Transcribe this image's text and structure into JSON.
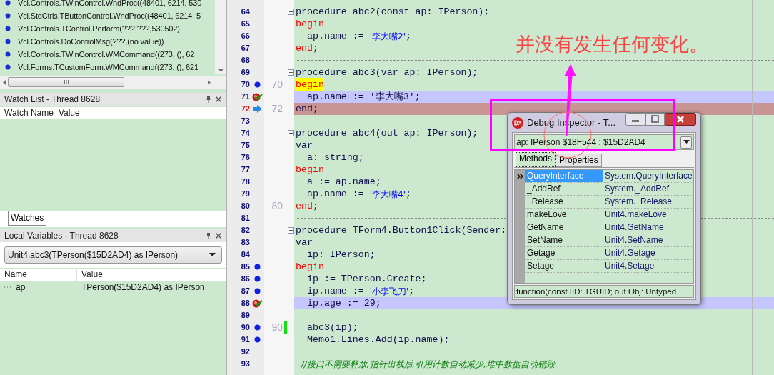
{
  "call_stack": {
    "frames": [
      "Vcl.Controls.TWinControl.WndProc((48401, 6214, 530",
      "Vcl.StdCtrls.TButtonControl.WndProc((48401, 6214, 5",
      "Vcl.Controls.TControl.Perform(???,???,530502)",
      "Vcl.Controls.DoControlMsg(???,(no value))",
      "Vcl.Controls.TWinControl.WMCommand((273, (), 62",
      "Vcl.Forms.TCustomForm.WMCommand((273, (), 621"
    ]
  },
  "watch_list": {
    "title": "Watch List - Thread 8628",
    "columns": [
      "Watch Name",
      "Value"
    ]
  },
  "bottom_tabs": [
    {
      "label": "Watches",
      "selected": true
    }
  ],
  "local_variables": {
    "title": "Local Variables - Thread 8628",
    "frame": "Unit4.abc3(TPerson($15D2AD4) as IPerson)",
    "columns": [
      "Name",
      "Value"
    ],
    "rows": [
      {
        "name": "ap",
        "value": "TPerson($15D2AD4) as IPerson"
      }
    ]
  },
  "editor": {
    "lines": [
      {
        "number": "64",
        "kind": "header",
        "modified": false,
        "tokens": [
          {
            "text": "procedure abc2(const ap: IPerson);",
            "kind": "plain"
          }
        ]
      },
      {
        "number": "65",
        "kind": "code",
        "modified": false,
        "tokens": [
          {
            "text": "begin",
            "kind": "block"
          }
        ]
      },
      {
        "number": "66",
        "kind": "code",
        "modified": false,
        "tokens": [
          {
            "text": "  ap.name := ",
            "kind": "plain"
          },
          {
            "text": "'李大嘴2'",
            "kind": "string"
          },
          {
            "text": ";",
            "kind": "plain"
          }
        ]
      },
      {
        "number": "67",
        "kind": "code",
        "modified": false,
        "tokens": [
          {
            "text": "end",
            "kind": "block"
          },
          {
            "text": ";",
            "kind": "plain"
          }
        ]
      },
      {
        "number": "68",
        "kind": "separator",
        "modified": false
      },
      {
        "number": "69",
        "kind": "header",
        "modified": false,
        "tokens": [
          {
            "text": "procedure abc3(var ap: IPerson);",
            "kind": "plain"
          }
        ]
      },
      {
        "number": "70",
        "kind": "code",
        "marker": {
          "kind": "breakpoint"
        },
        "label": "70",
        "modified": false,
        "tokens": [
          {
            "text": "begin",
            "kind": "block_current"
          }
        ]
      },
      {
        "number": "71",
        "kind": "code",
        "marker": {
          "kind": "verified"
        },
        "modified": false,
        "tokens": [
          {
            "text": "  ap.name := ",
            "kind": "plain"
          },
          {
            "text": "'李大嘴3'",
            "kind": "string"
          },
          {
            "text": ";",
            "kind": "plain"
          }
        ]
      },
      {
        "number": "72",
        "kind": "code",
        "marker": {
          "kind": "execution"
        },
        "label": "72",
        "modified": false,
        "tokens": [
          {
            "text": "end",
            "kind": "block"
          },
          {
            "text": ";",
            "kind": "plain"
          }
        ]
      },
      {
        "number": "73",
        "kind": "separator",
        "modified": false
      },
      {
        "number": "74",
        "kind": "header",
        "modified": false,
        "tokens": [
          {
            "text": "procedure abc4(out ap: IPerson);",
            "kind": "plain"
          }
        ]
      },
      {
        "number": "75",
        "kind": "code",
        "modified": false,
        "tokens": [
          {
            "text": "var",
            "kind": "plain"
          }
        ]
      },
      {
        "number": "76",
        "kind": "code",
        "modified": false,
        "tokens": [
          {
            "text": "  a: string;",
            "kind": "plain"
          }
        ]
      },
      {
        "number": "77",
        "kind": "code",
        "modified": false,
        "tokens": [
          {
            "text": "begin",
            "kind": "block"
          }
        ]
      },
      {
        "number": "78",
        "kind": "code",
        "modified": false,
        "tokens": [
          {
            "text": "  a := ap.name;",
            "kind": "plain"
          }
        ]
      },
      {
        "number": "79",
        "kind": "code",
        "modified": false,
        "tokens": [
          {
            "text": "  ap.name := ",
            "kind": "plain"
          },
          {
            "text": "'李大嘴4'",
            "kind": "string"
          },
          {
            "text": ";",
            "kind": "plain"
          }
        ]
      },
      {
        "number": "80",
        "kind": "code",
        "label": "80",
        "modified": false,
        "tokens": [
          {
            "text": "end",
            "kind": "block"
          },
          {
            "text": ";",
            "kind": "plain"
          }
        ]
      },
      {
        "number": "81",
        "kind": "separator",
        "modified": false
      },
      {
        "number": "82",
        "kind": "header",
        "modified": false,
        "tokens": [
          {
            "text": "procedure TForm4.Button1Click(Sender:",
            "kind": "plain"
          }
        ]
      },
      {
        "number": "83",
        "kind": "code",
        "modified": false,
        "tokens": [
          {
            "text": "var",
            "kind": "plain"
          }
        ]
      },
      {
        "number": "84",
        "kind": "code",
        "modified": false,
        "tokens": [
          {
            "text": "  ip: IPerson;",
            "kind": "plain"
          }
        ]
      },
      {
        "number": "85",
        "kind": "code",
        "marker": {
          "kind": "breakpoint"
        },
        "modified": false,
        "tokens": [
          {
            "text": "begin",
            "kind": "block"
          }
        ]
      },
      {
        "number": "86",
        "kind": "code",
        "marker": {
          "kind": "breakpoint"
        },
        "modified": false,
        "tokens": [
          {
            "text": "  ip := TPerson.Create;",
            "kind": "plain"
          }
        ]
      },
      {
        "number": "87",
        "kind": "code",
        "marker": {
          "kind": "breakpoint"
        },
        "modified": false,
        "tokens": [
          {
            "text": "  ip.name := ",
            "kind": "plain"
          },
          {
            "text": "'小李飞刀'",
            "kind": "string"
          },
          {
            "text": ";",
            "kind": "plain"
          }
        ]
      },
      {
        "number": "88",
        "kind": "code",
        "marker": {
          "kind": "verified"
        },
        "modified": false,
        "tokens": [
          {
            "text": "  ip.age := 29;",
            "kind": "plain"
          }
        ]
      },
      {
        "number": "89",
        "kind": "code",
        "modified": false
      },
      {
        "number": "90",
        "kind": "code",
        "marker": {
          "kind": "breakpoint"
        },
        "label": "90",
        "modified": true,
        "tokens": [
          {
            "text": "  abc3(ip);",
            "kind": "plain"
          }
        ]
      },
      {
        "number": "91",
        "kind": "code",
        "marker": {
          "kind": "breakpoint"
        },
        "modified": false,
        "tokens": [
          {
            "text": "  Memo1.Lines.Add(ip.name);",
            "kind": "plain"
          }
        ]
      },
      {
        "number": "92",
        "kind": "code",
        "modified": false
      },
      {
        "number": "93",
        "kind": "code",
        "modified": false,
        "tokens": [
          {
            "text": "  //接口不需要释放,指针出栈后,引用计数自动减少,堆中数据自动销毁.",
            "kind": "comment"
          }
        ]
      }
    ]
  },
  "debug_inspector": {
    "title": "Debug Inspector - T...",
    "selector": "ap: IPerson $18F544 : $15D2AD4",
    "tabs": [
      {
        "label": "Methods",
        "selected": true
      },
      {
        "label": "Properties",
        "selected": false
      }
    ],
    "rows": [
      {
        "name": "QueryInterface",
        "value": "System.QueryInterface",
        "selected": true
      },
      {
        "name": "_AddRef",
        "value": "System._AddRef",
        "selected": false
      },
      {
        "name": "_Release",
        "value": "System._Release",
        "selected": false
      },
      {
        "name": "makeLove",
        "value": "Unit4.makeLove",
        "selected": false
      },
      {
        "name": "GetName",
        "value": "Unit4.GetName",
        "selected": false
      },
      {
        "name": "SetName",
        "value": "Unit4.SetName",
        "selected": false
      },
      {
        "name": "Getage",
        "value": "Unit4.Getage",
        "selected": false
      },
      {
        "name": "Setage",
        "value": "Unit4.Setage",
        "selected": false
      }
    ],
    "status": "function(const IID: TGUID; out Obj: Untyped"
  },
  "annotation": {
    "text": "并没有发生任何变化。"
  }
}
